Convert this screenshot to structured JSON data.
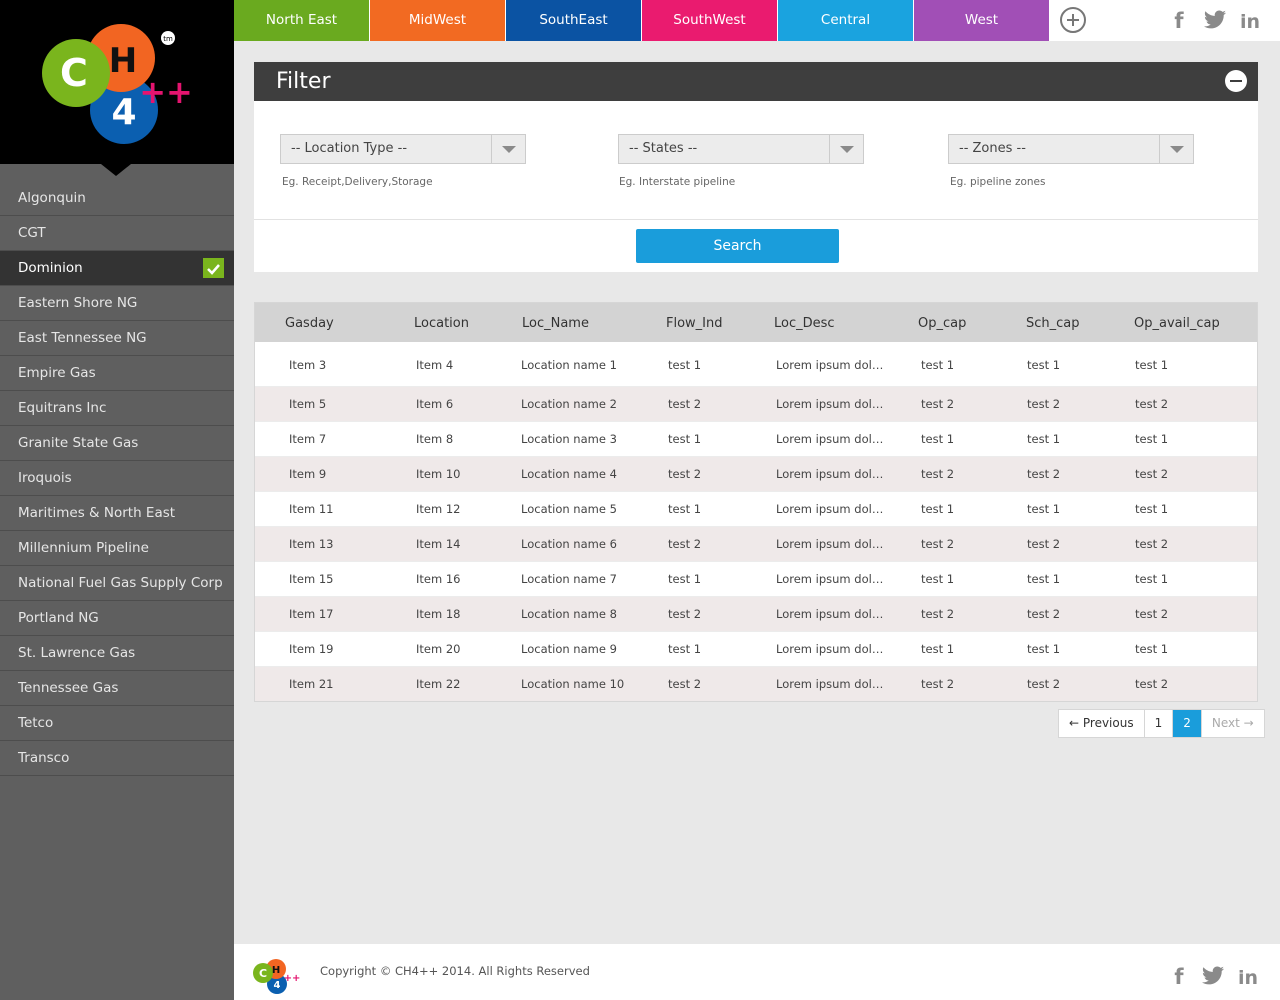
{
  "brand": {
    "logo_c": "C",
    "logo_h": "H",
    "logo_4": "4",
    "logo_pp": "++",
    "logo_tm": "tm"
  },
  "colors": {
    "green": "#7ab51d",
    "orange": "#f26522",
    "blue": "#0b5fb0",
    "magenta": "#e4146f",
    "cyan": "#1a9ddb",
    "purple": "#9b4fb0",
    "dark": "#3e3e3e"
  },
  "regions": [
    {
      "label": "North East",
      "color": "#6aaa1f"
    },
    {
      "label": "MidWest",
      "color": "#f26a22"
    },
    {
      "label": "SouthEast",
      "color": "#0b53a3"
    },
    {
      "label": "SouthWest",
      "color": "#ea1b6f"
    },
    {
      "label": "Central",
      "color": "#1aa3df"
    },
    {
      "label": "West",
      "color": "#a14fb6"
    }
  ],
  "sidebar": {
    "items": [
      {
        "label": "Algonquin",
        "active": false
      },
      {
        "label": "CGT",
        "active": false
      },
      {
        "label": "Dominion",
        "active": true
      },
      {
        "label": "Eastern Shore NG",
        "active": false
      },
      {
        "label": "East Tennessee NG",
        "active": false
      },
      {
        "label": "Empire Gas",
        "active": false
      },
      {
        "label": "Equitrans Inc",
        "active": false
      },
      {
        "label": "Granite State Gas",
        "active": false
      },
      {
        "label": "Iroquois",
        "active": false
      },
      {
        "label": "Maritimes & North East",
        "active": false
      },
      {
        "label": "Millennium Pipeline",
        "active": false
      },
      {
        "label": "National Fuel Gas Supply Corp",
        "active": false
      },
      {
        "label": "Portland NG",
        "active": false
      },
      {
        "label": "St. Lawrence Gas",
        "active": false
      },
      {
        "label": "Tennessee Gas",
        "active": false
      },
      {
        "label": "Tetco",
        "active": false
      },
      {
        "label": "Transco",
        "active": false
      }
    ]
  },
  "filter": {
    "title": "Filter",
    "location_type": {
      "value": "-- Location Type --",
      "hint": "Eg. Receipt,Delivery,Storage"
    },
    "states": {
      "value": "-- States --",
      "hint": "Eg. Interstate pipeline"
    },
    "zones": {
      "value": "-- Zones --",
      "hint": "Eg. pipeline zones"
    },
    "search_label": "Search"
  },
  "table": {
    "columns": [
      "Gasday",
      "Location",
      "Loc_Name",
      "Flow_Ind",
      "Loc_Desc",
      "Op_cap",
      "Sch_cap",
      "Op_avail_cap"
    ],
    "rows": [
      [
        "Item 3",
        "Item 4",
        "Location name 1",
        "test 1",
        "Lorem ipsum dolor sit amet",
        "test 1",
        "test 1",
        "test 1"
      ],
      [
        "Item 5",
        "Item 6",
        "Location name 2",
        "test 2",
        "Lorem ipsum dolor sit amet",
        "test 2",
        "test 2",
        "test 2"
      ],
      [
        "Item 7",
        "Item 8",
        "Location name 3",
        "test 1",
        "Lorem ipsum dolor sit amet",
        "test 1",
        "test 1",
        "test 1"
      ],
      [
        "Item 9",
        "Item 10",
        "Location name 4",
        "test 2",
        "Lorem ipsum dolor sit amet",
        "test 2",
        "test 2",
        "test 2"
      ],
      [
        "Item 11",
        "Item 12",
        "Location name 5",
        "test 1",
        "Lorem ipsum dolor sit amet",
        "test 1",
        "test 1",
        "test 1"
      ],
      [
        "Item 13",
        "Item 14",
        "Location name 6",
        "test 2",
        "Lorem ipsum dolor sit amet",
        "test 2",
        "test 2",
        "test 2"
      ],
      [
        "Item 15",
        "Item 16",
        "Location name 7",
        "test 1",
        "Lorem ipsum dolor sit amet",
        "test 1",
        "test 1",
        "test 1"
      ],
      [
        "Item 17",
        "Item 18",
        "Location name 8",
        "test 2",
        "Lorem ipsum dolor sit amet",
        "test 2",
        "test 2",
        "test 2"
      ],
      [
        "Item 19",
        "Item 20",
        "Location name 9",
        "test 1",
        "Lorem ipsum dolor sit amet",
        "test 1",
        "test 1",
        "test 1"
      ],
      [
        "Item 21",
        "Item 22",
        "Location name 10",
        "test 2",
        "Lorem ipsum dolor sit amet",
        "test 2",
        "test 2",
        "test 2"
      ]
    ]
  },
  "pagination": {
    "previous": "← Previous",
    "pages": [
      "1",
      "2"
    ],
    "current": "2",
    "next": "Next →"
  },
  "social": {
    "facebook": "f",
    "twitter_icon": "twitter-icon",
    "linkedin": "in"
  },
  "footer": {
    "copyright": "Copyright © CH4++ 2014. All Rights Reserved"
  }
}
